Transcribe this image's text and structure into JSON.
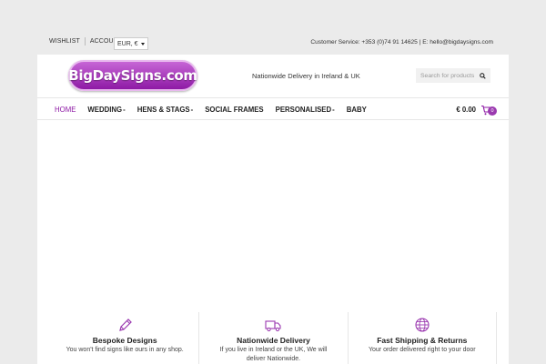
{
  "topbar": {
    "wishlist": "WISHLIST",
    "account": "ACCOUNT",
    "currency": "EUR, €",
    "service_text": "Customer Service: +353 (0)74 91 14625 | E: hello@bigdaysigns.com"
  },
  "header": {
    "logo_text": "BigDaySigns.com",
    "delivery_text": "Nationwide Delivery in Ireland & UK",
    "search_placeholder": "Search for products"
  },
  "nav": {
    "items": [
      {
        "label": "HOME",
        "active": true,
        "dropdown": ""
      },
      {
        "label": "WEDDING",
        "active": false,
        "dropdown": "-"
      },
      {
        "label": "HENS & STAGS",
        "active": false,
        "dropdown": "-"
      },
      {
        "label": "SOCIAL FRAMES",
        "active": false,
        "dropdown": ""
      },
      {
        "label": "PERSONALISED",
        "active": false,
        "dropdown": "-"
      },
      {
        "label": "BABY",
        "active": false,
        "dropdown": ""
      }
    ],
    "cart_amount": "€ 0.00",
    "cart_count": "0"
  },
  "features": [
    {
      "icon": "pencil-icon",
      "title": "Bespoke Designs",
      "text": "You won't find signs like ours in any shop."
    },
    {
      "icon": "truck-icon",
      "title": "Nationwide Delivery",
      "text": "If you live in Ireland or the UK, We will deliver Nationwide."
    },
    {
      "icon": "globe-icon",
      "title": "Fast Shipping & Returns",
      "text": "Your order delivered right to your door"
    }
  ],
  "colors": {
    "accent": "#8e1aa5",
    "badge": "#9b3ab0",
    "page_bg": "#ebebeb"
  }
}
